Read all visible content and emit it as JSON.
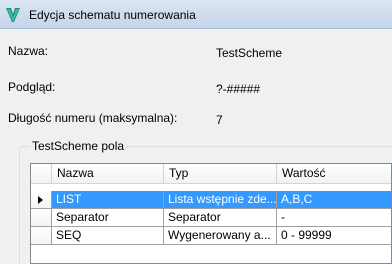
{
  "window": {
    "title": "Edycja schematu numerowania"
  },
  "properties": [
    {
      "label": "Nazwa:",
      "value": "TestScheme"
    },
    {
      "label": "Podgląd:",
      "value": "?-#####"
    },
    {
      "label": "Długość numeru (maksymalna):",
      "value": "7"
    }
  ],
  "fields_group": {
    "title": "TestScheme pola",
    "columns": [
      "Nazwa",
      "Typ",
      "Wartość"
    ],
    "rows": [
      {
        "name": "LIST",
        "type": "Lista wstępnie zde...",
        "value": "A,B,C",
        "selected": true
      },
      {
        "name": "Separator",
        "type": "Separator",
        "value": "-",
        "selected": false
      },
      {
        "name": "SEQ",
        "type": "Wygenerowany a...",
        "value": "0 - 99999",
        "selected": false
      }
    ]
  },
  "colors": {
    "selection": "#3399ff",
    "window_bg": "#f0f0f0",
    "titlebar": "#c4d4e8"
  }
}
